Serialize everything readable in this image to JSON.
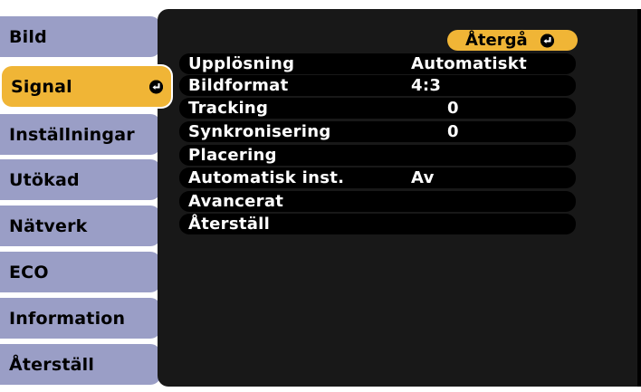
{
  "menu": {
    "items": [
      {
        "label": "Bild"
      },
      {
        "label": "Signal"
      },
      {
        "label": "Inställningar"
      },
      {
        "label": "Utökad"
      },
      {
        "label": "Nätverk"
      },
      {
        "label": "ECO"
      },
      {
        "label": "Information"
      },
      {
        "label": "Återställ"
      }
    ],
    "selected": "Signal"
  },
  "panel": {
    "back_label": "Återgå",
    "rows": [
      {
        "label": "Upplösning",
        "value": "Automatiskt"
      },
      {
        "label": "Bildformat",
        "value": "4:3"
      },
      {
        "label": "Tracking",
        "value": "0"
      },
      {
        "label": "Synkronisering",
        "value": "0"
      },
      {
        "label": "Placering",
        "value": ""
      },
      {
        "label": "Automatisk inst.",
        "value": "Av"
      },
      {
        "label": "Avancerat",
        "value": ""
      },
      {
        "label": "Återställ",
        "value": ""
      }
    ]
  },
  "colors": {
    "tab": "#9a9ec6",
    "selected": "#f0b536",
    "panel": "#181818",
    "row": "#000000",
    "text_on_dark": "#ffffff"
  },
  "icons": {
    "enter": "enter-return-icon"
  }
}
